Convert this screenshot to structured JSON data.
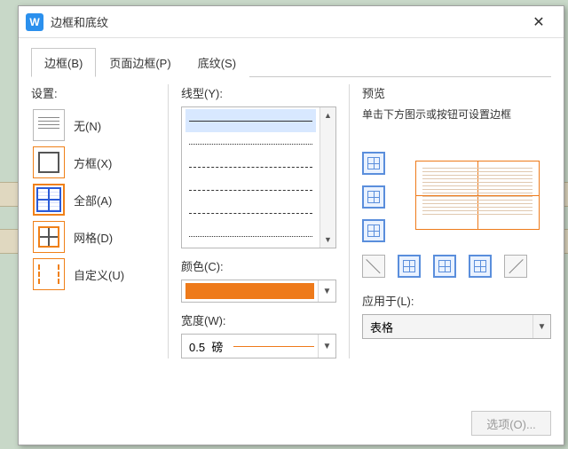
{
  "window": {
    "title": "边框和底纹",
    "close_glyph": "✕"
  },
  "tabs": [
    {
      "label": "边框(B)"
    },
    {
      "label": "页面边框(P)"
    },
    {
      "label": "底纹(S)"
    }
  ],
  "setting": {
    "label": "设置:",
    "presets": [
      {
        "name": "none",
        "label": "无(N)"
      },
      {
        "name": "box",
        "label": "方框(X)"
      },
      {
        "name": "all",
        "label": "全部(A)"
      },
      {
        "name": "grid",
        "label": "网格(D)"
      },
      {
        "name": "custom",
        "label": "自定义(U)"
      }
    ],
    "selected": "all"
  },
  "linestyle": {
    "label": "线型(Y):",
    "selected_index": 0,
    "items": [
      "solid",
      "dotted-fine",
      "dashed",
      "dashed-wide",
      "dash-dot",
      "dash-dot-dot"
    ]
  },
  "color": {
    "label": "颜色(C):",
    "value": "#ee7a1a"
  },
  "width": {
    "label": "宽度(W):",
    "value": "0.5",
    "unit": "磅"
  },
  "preview": {
    "label": "预览",
    "hint": "单击下方图示或按钮可设置边框"
  },
  "apply": {
    "label": "应用于(L):",
    "value": "表格"
  },
  "options_button": "选项(O)..."
}
